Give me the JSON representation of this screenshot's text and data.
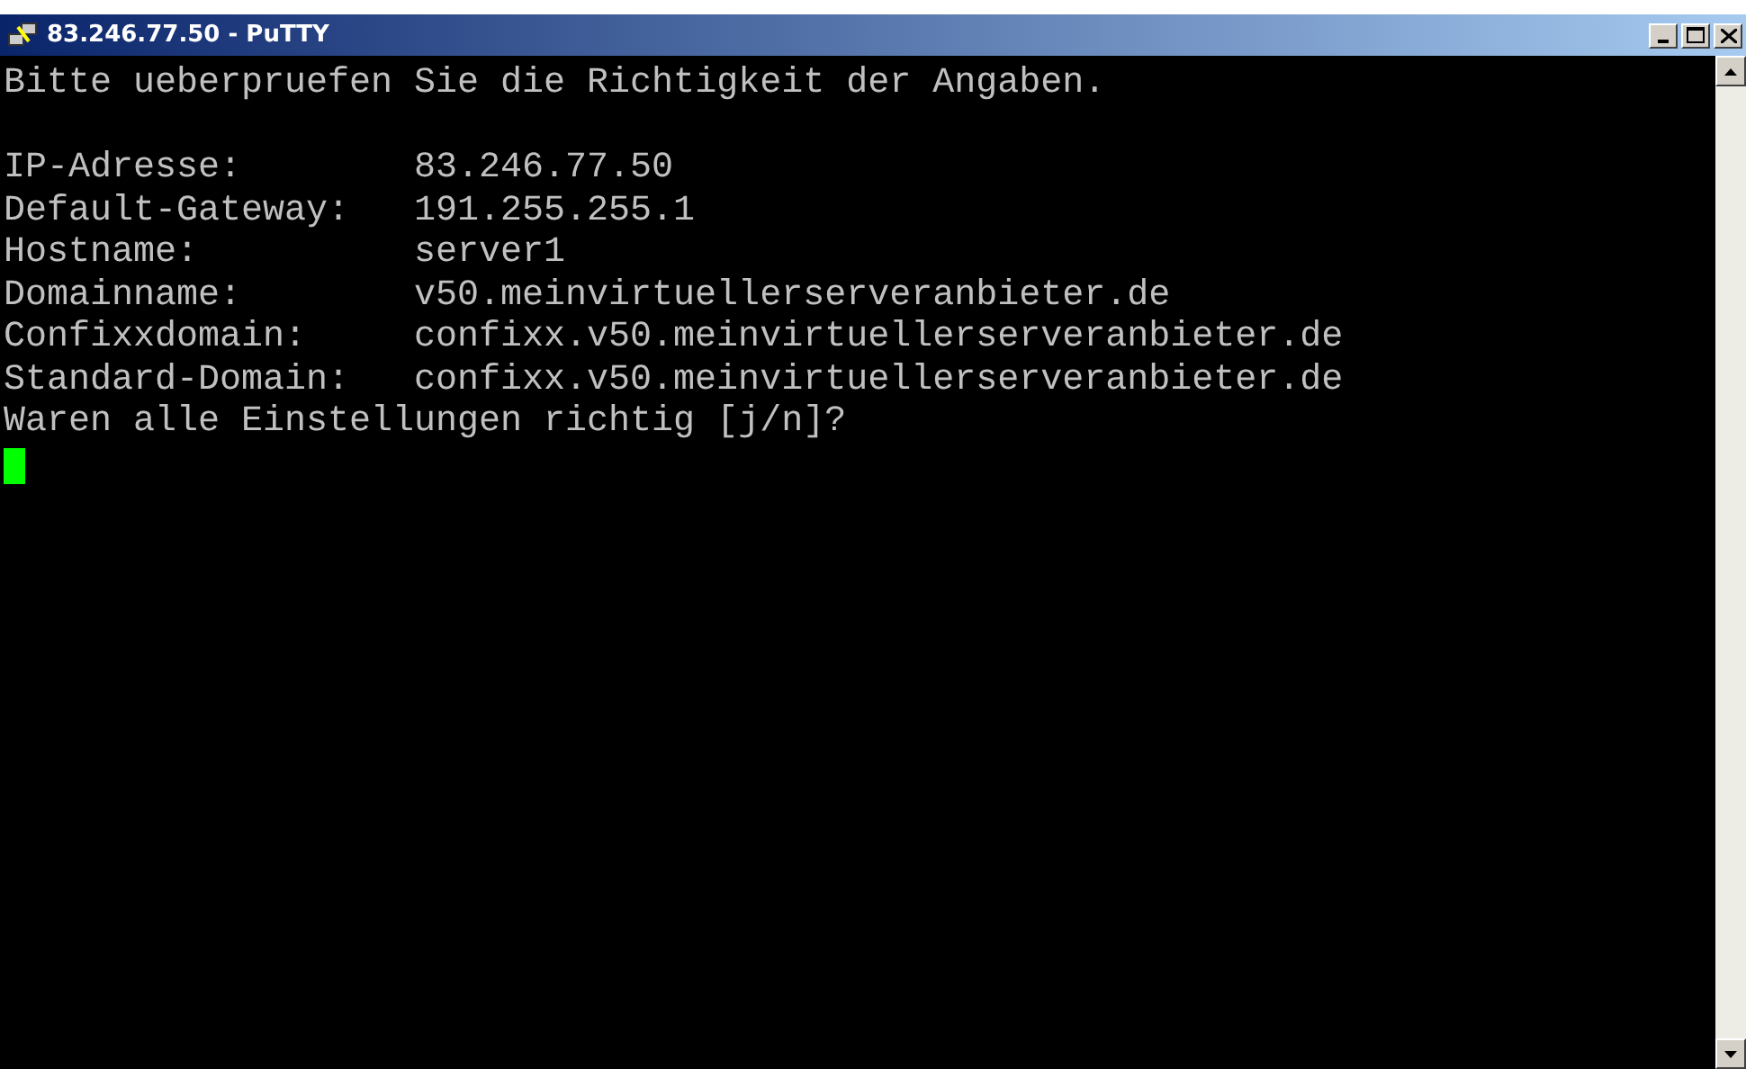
{
  "window": {
    "title": "83.246.77.50 - PuTTY"
  },
  "terminal": {
    "header": "Bitte ueberpruefen Sie die Richtigkeit der Angaben.",
    "settings": [
      {
        "label": "IP-Adresse:",
        "value": "83.246.77.50"
      },
      {
        "label": "Default-Gateway:",
        "value": "191.255.255.1"
      },
      {
        "label": "Hostname:",
        "value": "server1"
      },
      {
        "label": "Domainname:",
        "value": "v50.meinvirtuellerserveranbieter.de"
      },
      {
        "label": "Confixxdomain:",
        "value": "confixx.v50.meinvirtuellerserveranbieter.de"
      },
      {
        "label": "Standard-Domain:",
        "value": "confixx.v50.meinvirtuellerserveranbieter.de"
      }
    ],
    "prompt": "Waren alle Einstellungen richtig [j/n]?"
  }
}
